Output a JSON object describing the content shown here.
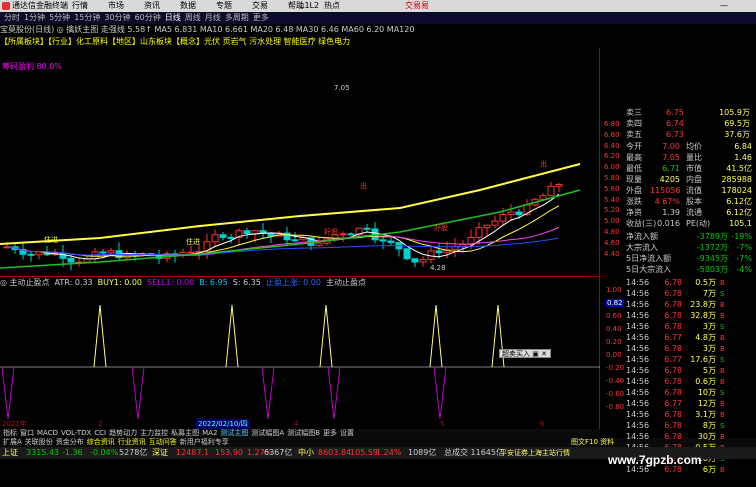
{
  "app": {
    "title": "通达信金融终端",
    "menus": [
      "行情",
      "市场",
      "资讯",
      "数据",
      "专题",
      "交易",
      "帮助",
      "热点"
    ],
    "account": "L1L2",
    "quick_trade": "交易易",
    "window_controls": "— □ ✕"
  },
  "periods": {
    "items": [
      "分时",
      "1分钟",
      "5分钟",
      "15分钟",
      "30分钟",
      "60分钟",
      "日线",
      "周线",
      "月线",
      "多周期",
      "更多"
    ],
    "selected": "日线"
  },
  "stock": {
    "info_line": "宝莫股份(日线) ◎ 擒妖主图  走强线 5.58↑  MA5 6.831  MA10 6.661  MA20 6.48  MA30 6.46  MA60 6.20  MA120"
  },
  "concepts": "【所属板块】【行业】化工原料【地区】山东板块【概念】光伏 页岩气 污水处理 智能医疗 绿色电力",
  "chip_profit": "筹码盈利 80.0%",
  "price_axis": [
    "6.80",
    "6.60",
    "6.40",
    "6.20",
    "6.00",
    "5.80",
    "5.60",
    "5.40",
    "5.20",
    "5.00",
    "4.80",
    "4.60",
    "4.40"
  ],
  "chart_labels": {
    "low_price": "4.28",
    "high_price": "7.05",
    "signals": [
      "住进",
      "住进",
      "好股",
      "好股",
      "出",
      "出"
    ]
  },
  "indicator": {
    "legend": [
      "◎ 主动止盈点",
      "ATR: 0.33",
      "BUY1: 0.00",
      "SELL1: 0.00",
      "B: 6.95",
      "S: 6.35",
      "止盈上涨: 0.00",
      "主动止盈点"
    ],
    "axis": [
      "1.00",
      "0.82",
      "0.60",
      "0.40",
      "0.20",
      "0.00",
      "-0.20",
      "-0.40",
      "-0.60",
      "-0.80"
    ],
    "value_tag": "0.82",
    "popup": "超卖买入 ▣ ✕"
  },
  "date_axis": {
    "labels": [
      "2021年",
      "2",
      "3",
      "2022/02/10/四",
      "4",
      "5",
      "6"
    ]
  },
  "tabs_row1": {
    "items": [
      "指标",
      "窗口",
      "MACD",
      "VOL-TDX",
      "CCI",
      "趋势动力",
      "主力监控",
      "私募主图",
      "MA2",
      "测试主图",
      "测试幅图A",
      "测试幅图B",
      "更多",
      "设置"
    ],
    "active": "测试主图"
  },
  "tabs_row2": {
    "items": [
      "扩展A",
      "关联股份",
      "资金分布",
      "综合资讯",
      "行业资讯",
      "互动问答",
      "新用户福利专享"
    ],
    "right": "图文F10 资料"
  },
  "quote": {
    "sell_levels": [
      {
        "label": "卖三",
        "price": "6.75",
        "vol": "105.9万"
      },
      {
        "label": "卖四",
        "price": "6.74",
        "vol": "69.5万"
      },
      {
        "label": "卖五",
        "price": "6.73",
        "vol": "37.6万"
      }
    ],
    "stats": [
      {
        "k1": "今开",
        "v1": "7.00",
        "k2": "均价",
        "v2": "6.84"
      },
      {
        "k1": "最高",
        "v1": "7.05",
        "k2": "量比",
        "v2": "1.46"
      },
      {
        "k1": "最低",
        "v1": "6.71",
        "k2": "市值",
        "v2": "41.5亿"
      },
      {
        "k1": "现量",
        "v1": "4205",
        "k2": "内盘",
        "v2": "285988"
      },
      {
        "k1": "外盘",
        "v1": "115056",
        "k2": "流值",
        "v2": "178024"
      },
      {
        "k1": "涨跌",
        "v1": "4.67%",
        "k2": "股本",
        "v2": "6.12亿"
      },
      {
        "k1": "净资",
        "v1": "1.39",
        "k2": "流通",
        "v2": "6.12亿"
      },
      {
        "k1": "收益(三)",
        "v1": "0.016",
        "k2": "PE(动)",
        "v2": "105.1"
      }
    ],
    "capital": [
      {
        "label": "净流入额",
        "value": "-3789万",
        "pct": "-19%"
      },
      {
        "label": "大宗流入",
        "value": "-1372万",
        "pct": "-7%"
      },
      {
        "label": "5日净流入额",
        "value": "-9345万",
        "pct": "-7%"
      },
      {
        "label": "5日大宗流入",
        "value": "-5803万",
        "pct": "-4%"
      }
    ],
    "ticks": [
      {
        "t": "14:56",
        "p": "6.78",
        "v": "0.5万"
      },
      {
        "t": "14:56",
        "p": "6.78",
        "v": "7万"
      },
      {
        "t": "14:56",
        "p": "6.78",
        "v": "23.8万"
      },
      {
        "t": "14:56",
        "p": "6.78",
        "v": "32.8万"
      },
      {
        "t": "14:56",
        "p": "6.78",
        "v": "3万"
      },
      {
        "t": "14:56",
        "p": "6.77",
        "v": "4.8万"
      },
      {
        "t": "14:56",
        "p": "6.78",
        "v": "3万"
      },
      {
        "t": "14:56",
        "p": "6.77",
        "v": "17.6万"
      },
      {
        "t": "14:56",
        "p": "6.78",
        "v": "5万"
      },
      {
        "t": "14:56",
        "p": "6.78",
        "v": "0.6万"
      },
      {
        "t": "14:56",
        "p": "6.78",
        "v": "10万"
      },
      {
        "t": "14:56",
        "p": "6.77",
        "v": "12万"
      },
      {
        "t": "14:56",
        "p": "6.78",
        "v": "3.1万"
      },
      {
        "t": "14:56",
        "p": "6.78",
        "v": "8万"
      },
      {
        "t": "14:56",
        "p": "6.78",
        "v": "30万"
      },
      {
        "t": "14:56",
        "p": "6.78",
        "v": "0.5万"
      },
      {
        "t": "14:56",
        "p": "6.78",
        "v": "28万"
      },
      {
        "t": "14:56",
        "p": "6.78",
        "v": "6万"
      }
    ],
    "buy_sell_tabs": [
      "B",
      "S"
    ]
  },
  "status_bar": {
    "sh": {
      "name": "上证",
      "val": "3315.43",
      "chg": "-1.36",
      "pct": "-0.04%",
      "amt": "5278亿"
    },
    "sz": {
      "name": "深证",
      "val": "12487.1",
      "chg": "153.90",
      "pct": "1.27%",
      "amt": "6367亿"
    },
    "zx": {
      "name": "中小",
      "val": "8603.84",
      "chg": "105.59",
      "pct": "1.24%",
      "amt": "1089亿"
    },
    "total": "总成交 11645亿",
    "note": "平安证券上海主站行情"
  },
  "watermark": "www.7gpzb.com",
  "colors": {
    "up": "#ff3030",
    "down": "#00d0d0",
    "ma_yellow": "#ffff40",
    "ma_green": "#20c020",
    "ma_blue": "#2050ff",
    "signal_purple": "#c000c0",
    "signal_yellow": "#ffff80"
  }
}
